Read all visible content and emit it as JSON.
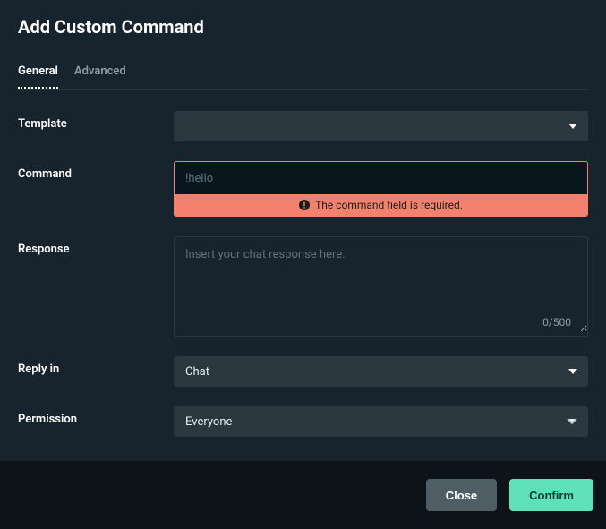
{
  "title": "Add Custom Command",
  "tabs": {
    "general": "General",
    "advanced": "Advanced"
  },
  "labels": {
    "template": "Template",
    "command": "Command",
    "response": "Response",
    "reply_in": "Reply in",
    "permission": "Permission"
  },
  "template": {
    "value": ""
  },
  "command": {
    "placeholder": "!hello",
    "value": "",
    "error": "The command field is required."
  },
  "response": {
    "placeholder": "Insert your chat response here.",
    "value": "",
    "counter": "0/500"
  },
  "reply_in": {
    "value": "Chat",
    "options": [
      "Chat"
    ]
  },
  "permission": {
    "value": "Everyone",
    "options": [
      "Everyone"
    ]
  },
  "footer": {
    "close": "Close",
    "confirm": "Confirm"
  }
}
